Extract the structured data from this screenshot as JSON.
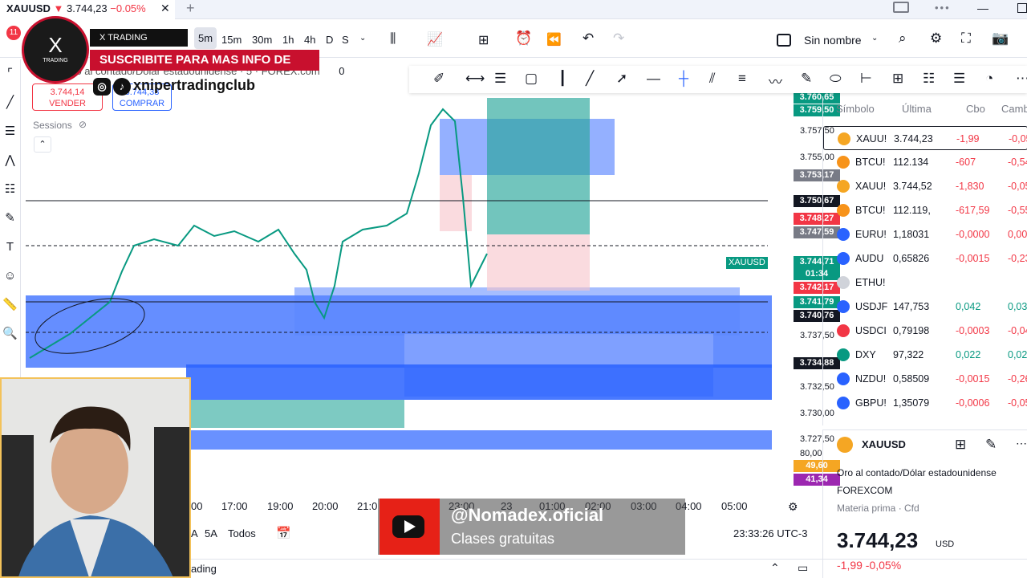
{
  "titlebar": {
    "symbol": "XAUUSD",
    "arrow": "▼",
    "price": "3.744,23",
    "change": "−0.05%",
    "close": "✕",
    "new_tab": "+",
    "badge_count": "11"
  },
  "toolbar": {
    "intervals": [
      "5m",
      "15m",
      "30m",
      "1h",
      "4h",
      "D",
      "S"
    ],
    "active_interval": "5m",
    "layout_name": "Sin nombre"
  },
  "overlay": {
    "logo_letter": "X",
    "logo_text": "TRADING",
    "banner": "X TRADING ACADEMIA",
    "subscribe": "SUSCRIBITE PARA MAS INFO DE VALOR!",
    "social": "xnipertradingclub",
    "yt_handle": "@Nomadex.oficial",
    "yt_sub": "Clases gratuitas"
  },
  "chart": {
    "legend_title": "Oro al contado/Dólar estadounidense · 5 · FOREX.com",
    "legend_zero": "0",
    "sell_price": "3.744,14",
    "sell_label": "VENDER",
    "buy_price": "3.744,33",
    "buy_label": "COMPRAR",
    "sessions": "Sessions",
    "symbol_tag": "XAUUSD",
    "price_labels": [
      "3.757,50",
      "3.755,00",
      "3.737,50",
      "3.732,50",
      "3.730,00",
      "3.727,50",
      "80,00"
    ],
    "price_tags": [
      {
        "text": "3.760,65",
        "color": "#089981"
      },
      {
        "text": "3.759,50",
        "color": "#089981"
      },
      {
        "text": "3.753,17",
        "color": "#787b86"
      },
      {
        "text": "3.750,67",
        "color": "#131722"
      },
      {
        "text": "3.748,27",
        "color": "#f23645"
      },
      {
        "text": "3.747,59",
        "color": "#787b86"
      },
      {
        "text": "3.744,71",
        "color": "#089981"
      },
      {
        "text": "01:34",
        "color": "#089981"
      },
      {
        "text": "3.742,17",
        "color": "#f23645"
      },
      {
        "text": "3.741,79",
        "color": "#089981"
      },
      {
        "text": "3.740,76",
        "color": "#131722"
      },
      {
        "text": "3.734,88",
        "color": "#131722"
      },
      {
        "text": "49,60",
        "color": "#f5a623"
      },
      {
        "text": "41,34",
        "color": "#9c27b0"
      }
    ],
    "time_labels": [
      "00",
      "17:00",
      "19:00",
      "20:00",
      "21:0",
      "23:00",
      "23",
      "01:00",
      "02:00",
      "03:00",
      "04:00",
      "05:00"
    ],
    "range_buttons": [
      "A",
      "5A",
      "Todos"
    ],
    "clock": "23:33:26 UTC-3",
    "bottom_tab": "ading"
  },
  "watchlist": {
    "headers": [
      "Símbolo",
      "Última",
      "Cbo",
      "Camb"
    ],
    "rows": [
      {
        "sym": "XAUU!",
        "last": "3.744,23",
        "chg": "-1,99",
        "pct": "-0,05",
        "dir": "down",
        "color": "#f5a623"
      },
      {
        "sym": "BTCU!",
        "last": "112.134",
        "chg": "-607",
        "pct": "-0,54",
        "dir": "down",
        "color": "#f7931a"
      },
      {
        "sym": "XAUU!",
        "last": "3.744,52",
        "chg": "-1,830",
        "pct": "-0,05",
        "dir": "down",
        "color": "#f5a623"
      },
      {
        "sym": "BTCU!",
        "last": "112.119,",
        "chg": "-617,59",
        "pct": "-0,55",
        "dir": "down",
        "color": "#f7931a"
      },
      {
        "sym": "EURU!",
        "last": "1,18031",
        "chg": "-0,0000",
        "pct": "0,00",
        "dir": "down",
        "color": "#2962ff"
      },
      {
        "sym": "AUDU",
        "last": "0,65826",
        "chg": "-0,0015",
        "pct": "-0,23",
        "dir": "down",
        "color": "#2962ff"
      },
      {
        "sym": "ETHU!",
        "last": "",
        "chg": "",
        "pct": "",
        "dir": "down",
        "color": "#d0d3da"
      },
      {
        "sym": "USDJF",
        "last": "147,753",
        "chg": "0,042",
        "pct": "0,03",
        "dir": "up",
        "color": "#2962ff"
      },
      {
        "sym": "USDCI",
        "last": "0,79198",
        "chg": "-0,0003",
        "pct": "-0,04",
        "dir": "down",
        "color": "#f23645"
      },
      {
        "sym": "DXY",
        "last": "97,322",
        "chg": "0,022",
        "pct": "0,02",
        "dir": "up",
        "color": "#089981"
      },
      {
        "sym": "NZDU!",
        "last": "0,58509",
        "chg": "-0,0015",
        "pct": "-0,26",
        "dir": "down",
        "color": "#2962ff"
      },
      {
        "sym": "GBPU!",
        "last": "1,35079",
        "chg": "-0,0006",
        "pct": "-0,05",
        "dir": "down",
        "color": "#2962ff"
      }
    ]
  },
  "detail": {
    "symbol": "XAUUSD",
    "description": "Oro al contado/Dólar estadounidense",
    "exchange": "FOREXCOM",
    "category": "Materia prima · Cfd",
    "price": "3.744,23",
    "currency": "USD",
    "change": "-1,99 -0,05%"
  }
}
